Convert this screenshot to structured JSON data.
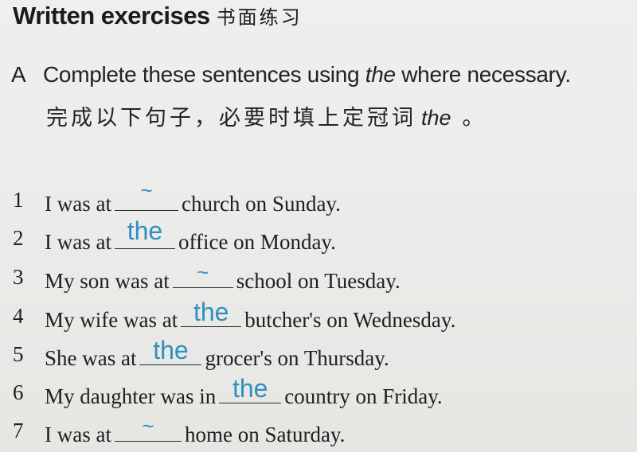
{
  "title": {
    "en": "Written exercises",
    "zh": "书面练习"
  },
  "section": {
    "letter": "A",
    "instruction_pre": "Complete these sentences using ",
    "instruction_em": "the",
    "instruction_post": " where necessary.",
    "zh_main": "完成以下句子，必要时填上定冠词",
    "zh_word": "the",
    "zh_end": "。"
  },
  "exercises": [
    {
      "num": "1",
      "before": "I was at",
      "answer": "~",
      "after": "church on Sunday."
    },
    {
      "num": "2",
      "before": "I was at",
      "answer": "the",
      "after": "office on Monday."
    },
    {
      "num": "3",
      "before": "My son was at",
      "answer": "~",
      "after": "school on Tuesday."
    },
    {
      "num": "4",
      "before": "My wife was at",
      "answer": "the",
      "after": "butcher's on Wednesday."
    },
    {
      "num": "5",
      "before": "She was at",
      "answer": "the",
      "after": "grocer's on Thursday."
    },
    {
      "num": "6",
      "before": "My daughter was in",
      "answer": "the",
      "after": "country on Friday."
    },
    {
      "num": "7",
      "before": "I was at",
      "answer": "~",
      "after": "home on Saturday."
    }
  ],
  "colors": {
    "answer_ink": "#2f8fbf",
    "text": "#1f1f20"
  }
}
